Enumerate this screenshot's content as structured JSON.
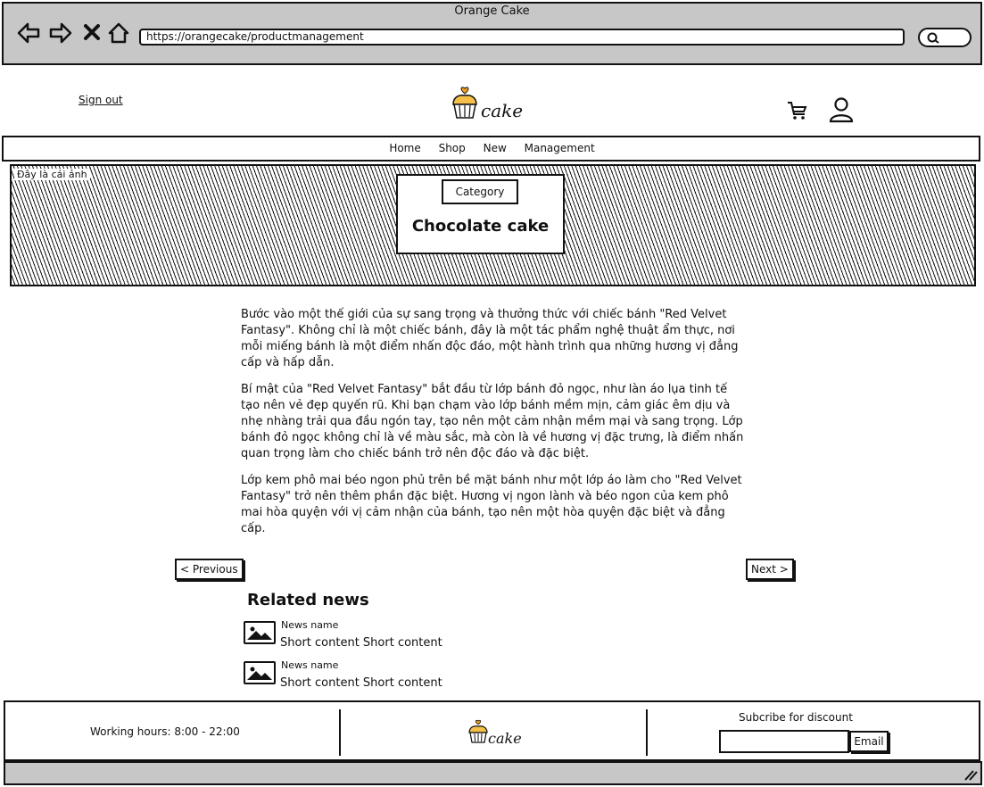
{
  "window": {
    "title": "Orange Cake"
  },
  "browser": {
    "url": "https://orangecake/productmanagement",
    "back_icon": "arrow-left-icon",
    "forward_icon": "arrow-right-icon",
    "close_icon": "x-icon",
    "home_icon": "home-icon"
  },
  "header": {
    "sign_out": "Sign out",
    "logo_text": "cake",
    "cart_icon": "cart-icon",
    "user_icon": "user-icon"
  },
  "nav": {
    "items": [
      "Home",
      "Shop",
      "New",
      "Management"
    ]
  },
  "banner": {
    "label": "Đây là cái ảnh",
    "category": "Category",
    "title": "Chocolate cake"
  },
  "article": {
    "paragraphs": [
      "Bước vào một thế giới của sự sang trọng và thưởng thức với chiếc bánh \"Red Velvet Fantasy\". Không chỉ là một chiếc bánh, đây là một tác phẩm nghệ thuật ẩm thực, nơi mỗi miếng bánh là một điểm nhấn độc đáo, một hành trình qua những hương vị đẳng cấp và hấp dẫn.",
      "Bí mật của \"Red Velvet Fantasy\" bắt đầu từ lớp bánh đỏ ngọc, như làn áo lụa tinh tế tạo nên vẻ đẹp quyến rũ. Khi bạn chạm vào lớp bánh mềm mịn, cảm giác êm dịu và nhẹ nhàng trải qua đầu ngón tay, tạo nên một cảm nhận mềm mại và sang trọng. Lớp bánh đỏ ngọc không chỉ là về màu sắc, mà còn là về hương vị đặc trưng, là điểm nhấn quan trọng làm cho chiếc bánh trở nên độc đáo và đặc biệt.",
      "Lớp kem phô mai béo ngon phủ trên bề mặt bánh như một lớp áo làm cho \"Red Velvet Fantasy\" trở nên thêm phần đặc biệt. Hương vị ngon lành và béo ngon của kem phô mai hòa quyện với vị cảm nhận của bánh, tạo nên một hòa quyện đặc biệt và đẳng cấp."
    ],
    "prev": "< Previous",
    "next": "Next >"
  },
  "related": {
    "title": "Related news",
    "items": [
      {
        "name": "News name",
        "short": "Short content Short content"
      },
      {
        "name": "News name",
        "short": "Short content Short content"
      }
    ]
  },
  "footer": {
    "hours": "Working hours: 8:00 - 22:00",
    "logo_text": "cake",
    "subscribe": "Subcribe for discount",
    "email_button": "Email"
  },
  "colors": {
    "chrome": "#c7c7c7",
    "logo_orange": "#f0a020"
  }
}
